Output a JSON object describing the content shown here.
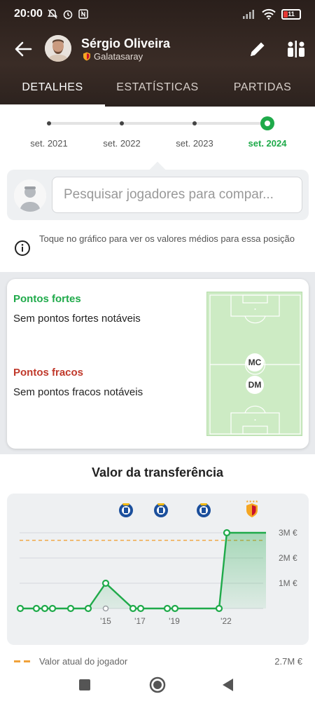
{
  "status": {
    "time": "20:00",
    "battery": "11"
  },
  "player": {
    "name": "Sérgio Oliveira",
    "team": "Galatasaray"
  },
  "tabs": [
    {
      "label": "DETALHES",
      "active": true
    },
    {
      "label": "ESTATÍSTICAS",
      "active": false
    },
    {
      "label": "PARTIDAS",
      "active": false
    }
  ],
  "timeline": {
    "labels": [
      "set. 2021",
      "set. 2022",
      "set. 2023",
      "set. 2024"
    ],
    "selected": "set. 2024"
  },
  "compare": {
    "placeholder": "Pesquisar jogadores para compar..."
  },
  "info": {
    "text": "Toque no gráfico para ver os valores médios para essa posição"
  },
  "strengths": {
    "strong_title": "Pontos fortes",
    "strong_text": "Sem pontos fortes notáveis",
    "weak_title": "Pontos fracos",
    "weak_text": "Sem pontos fracos notáveis",
    "positions": [
      "MC",
      "DM"
    ]
  },
  "transfer": {
    "title": "Valor da transferência",
    "legend_label": "Valor atual do jogador",
    "legend_value": "2.7M €"
  },
  "chart_data": {
    "type": "line",
    "x_tick_labels": [
      "'15",
      "'17",
      "'19",
      "'22"
    ],
    "y_tick_labels": [
      "1M €",
      "2M €",
      "3M €"
    ],
    "ylim": [
      0,
      3
    ],
    "series": [
      {
        "values": [
          0,
          0,
          0,
          0,
          0,
          0,
          1,
          0,
          0,
          0,
          0,
          0,
          3,
          3
        ]
      }
    ],
    "reference_line": 2.7,
    "club_icons": [
      "fc-porto-icon",
      "fc-porto-icon",
      "fc-porto-icon",
      "galatasaray-icon"
    ],
    "colors": {
      "line": "#1faa4a",
      "reference": "#f0a23a"
    }
  },
  "colors": {
    "accent": "#1faa4a",
    "strong": "#1faa4a",
    "weak": "#c0392b",
    "header": "#2e231f"
  }
}
